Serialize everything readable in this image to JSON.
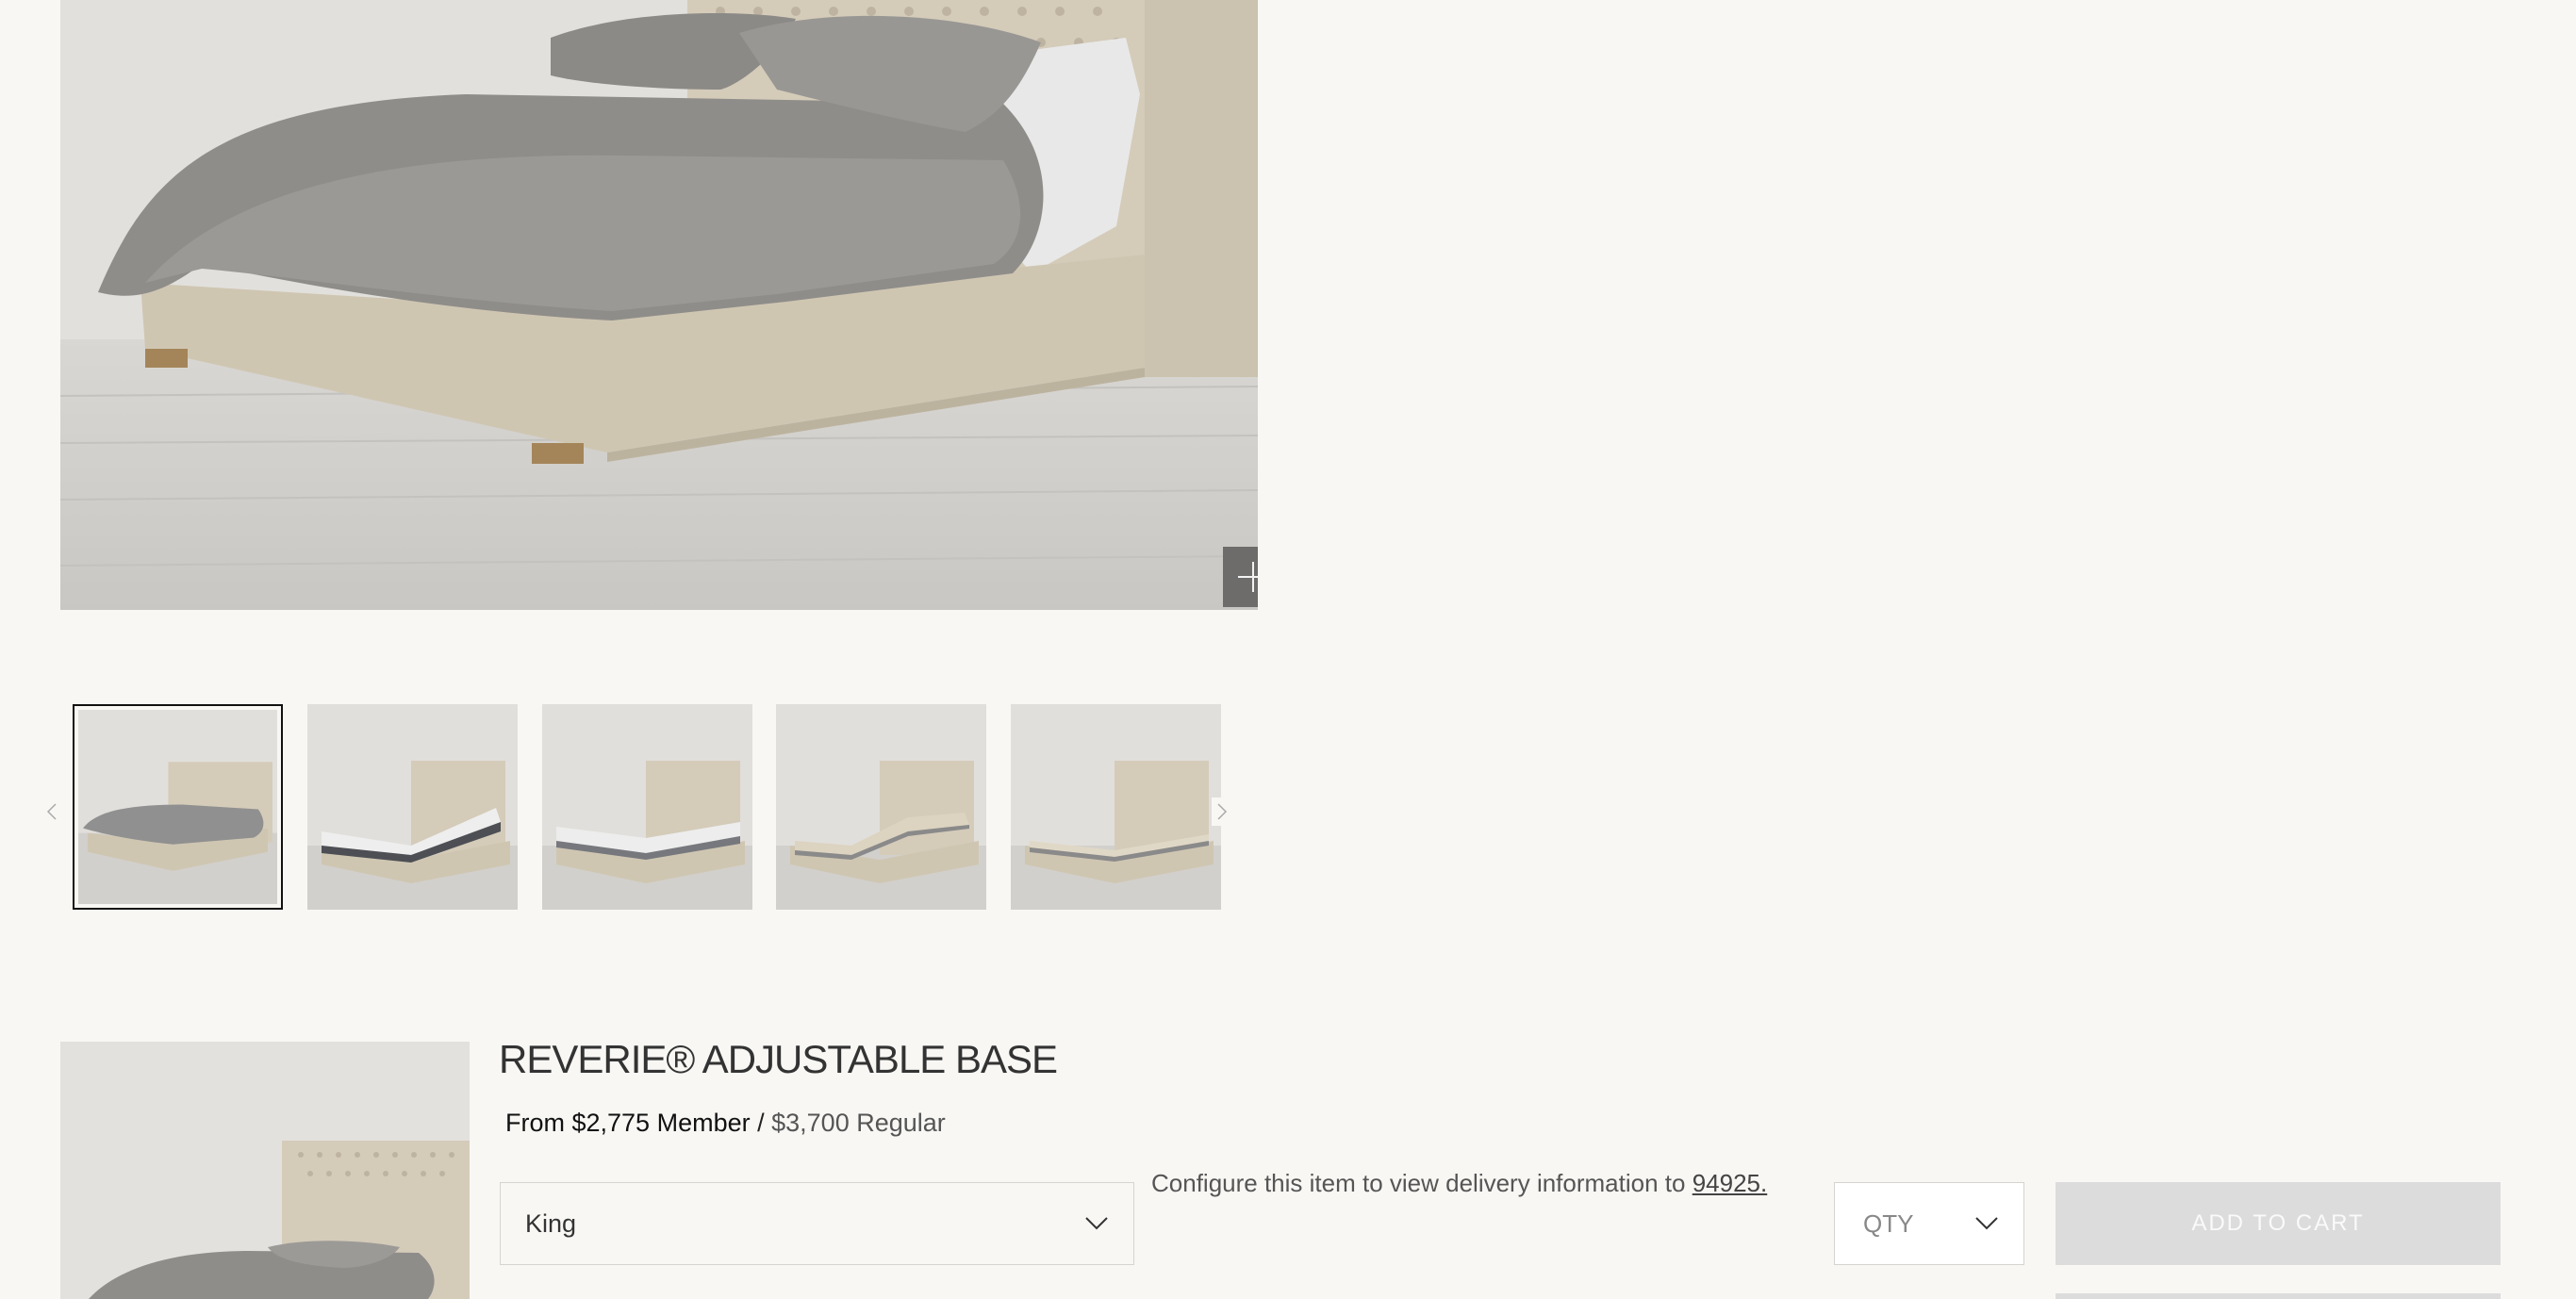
{
  "hero": {
    "zoom_icon": "plus-icon"
  },
  "carousel": {
    "prev_icon": "chevron-left-icon",
    "next_icon": "chevron-right-icon",
    "thumbnails": [
      {
        "variant": "bed-with-bedding"
      },
      {
        "variant": "bed-with-mattress-raised"
      },
      {
        "variant": "bed-with-mattress-flat"
      },
      {
        "variant": "adjustable-base-raised"
      },
      {
        "variant": "adjustable-base-flat"
      }
    ]
  },
  "product": {
    "title": "REVERIE® ADJUSTABLE BASE",
    "price_member": "From $2,775 Member",
    "price_separator": " / ",
    "price_regular": "$3,700 Regular",
    "size_select": {
      "value": "King",
      "icon": "chevron-down-icon"
    },
    "delivery_text": "Configure this item to view delivery information to ",
    "delivery_zip": "94925.",
    "qty": {
      "label": "QTY",
      "icon": "chevron-down-icon"
    },
    "add_to_cart_label": "ADD TO CART"
  },
  "colors": {
    "background": "#f8f7f4",
    "button_disabled": "#dcdcdc",
    "zoom_button": "#6e6c6a"
  }
}
